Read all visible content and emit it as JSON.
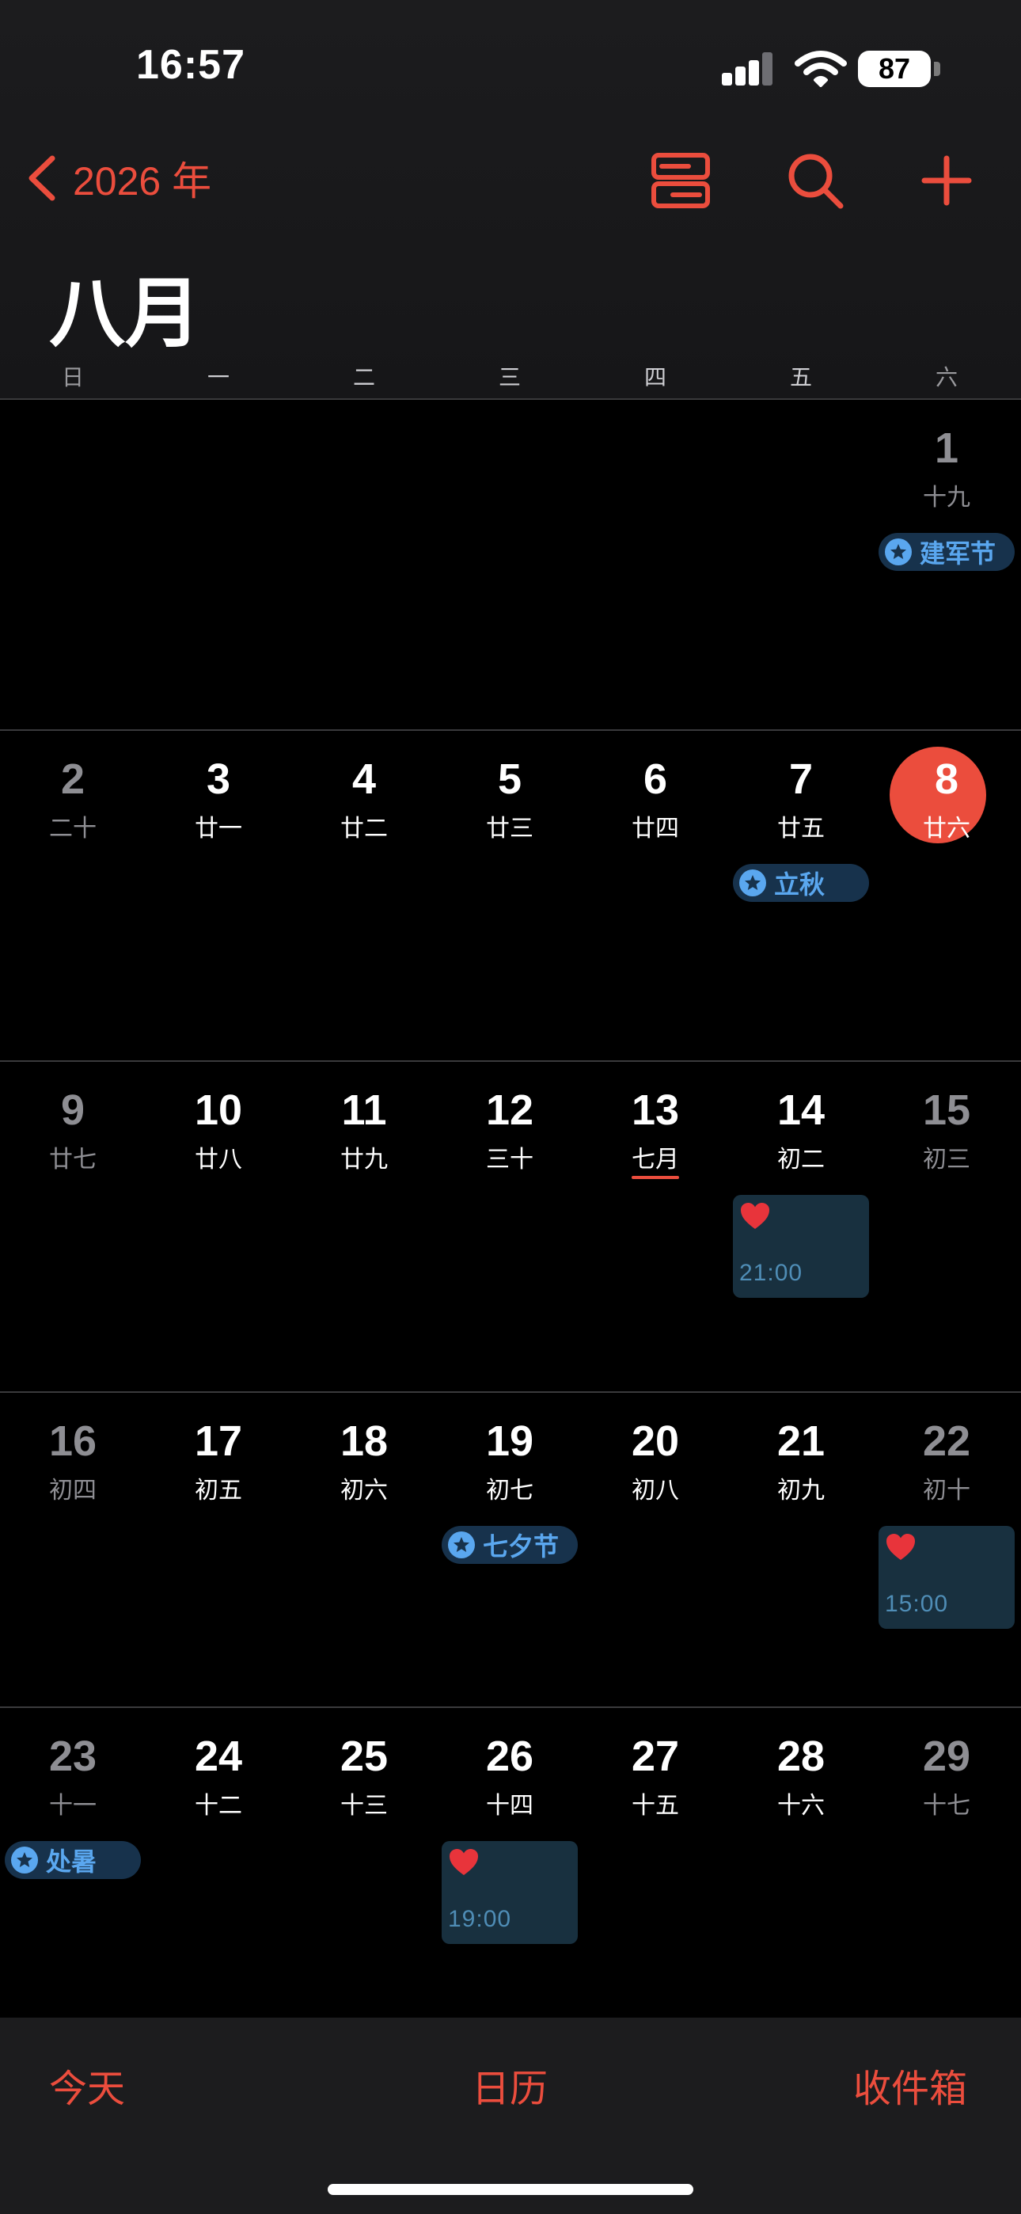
{
  "status_bar": {
    "time": "16:57",
    "battery": "87"
  },
  "nav": {
    "back_label": "2026 年",
    "icons": [
      "list-view-icon",
      "search-icon",
      "add-icon"
    ]
  },
  "month_title": "八月",
  "weekdays": [
    "日",
    "一",
    "二",
    "三",
    "四",
    "五",
    "六"
  ],
  "weeks": [
    {
      "days": [
        null,
        null,
        null,
        null,
        null,
        null,
        {
          "day": "1",
          "lunar": "十九"
        }
      ]
    },
    {
      "days": [
        {
          "day": "2",
          "lunar": "二十"
        },
        {
          "day": "3",
          "lunar": "廿一"
        },
        {
          "day": "4",
          "lunar": "廿二"
        },
        {
          "day": "5",
          "lunar": "廿三"
        },
        {
          "day": "6",
          "lunar": "廿四"
        },
        {
          "day": "7",
          "lunar": "廿五"
        },
        {
          "day": "8",
          "lunar": "廿六"
        }
      ]
    },
    {
      "days": [
        {
          "day": "9",
          "lunar": "廿七"
        },
        {
          "day": "10",
          "lunar": "廿八"
        },
        {
          "day": "11",
          "lunar": "廿九"
        },
        {
          "day": "12",
          "lunar": "三十"
        },
        {
          "day": "13",
          "lunar": "七月"
        },
        {
          "day": "14",
          "lunar": "初二"
        },
        {
          "day": "15",
          "lunar": "初三"
        }
      ]
    },
    {
      "days": [
        {
          "day": "16",
          "lunar": "初四"
        },
        {
          "day": "17",
          "lunar": "初五"
        },
        {
          "day": "18",
          "lunar": "初六"
        },
        {
          "day": "19",
          "lunar": "初七"
        },
        {
          "day": "20",
          "lunar": "初八"
        },
        {
          "day": "21",
          "lunar": "初九"
        },
        {
          "day": "22",
          "lunar": "初十"
        }
      ]
    },
    {
      "days": [
        {
          "day": "23",
          "lunar": "十一"
        },
        {
          "day": "24",
          "lunar": "十二"
        },
        {
          "day": "25",
          "lunar": "十三"
        },
        {
          "day": "26",
          "lunar": "十四"
        },
        {
          "day": "27",
          "lunar": "十五"
        },
        {
          "day": "28",
          "lunar": "十六"
        },
        {
          "day": "29",
          "lunar": "十七"
        }
      ]
    }
  ],
  "holidays": [
    {
      "day": "1",
      "label": "建军节"
    },
    {
      "day": "7",
      "label": "立秋"
    },
    {
      "day": "19",
      "label": "七夕节"
    },
    {
      "day": "23",
      "label": "处暑"
    }
  ],
  "events": [
    {
      "day": "14",
      "icon": "heart-icon",
      "time": "21:00"
    },
    {
      "day": "22",
      "icon": "heart-icon",
      "time": "15:00"
    },
    {
      "day": "26",
      "icon": "heart-icon",
      "time": "19:00"
    }
  ],
  "tabs": {
    "today": "今天",
    "calendars": "日历",
    "inbox": "收件箱"
  },
  "colors": {
    "accent": "#eb4d3d",
    "holiday": "#5aa7ef",
    "holiday_bg": "#17324c",
    "event_bg": "#18303f",
    "event_time": "#4f8db6"
  }
}
